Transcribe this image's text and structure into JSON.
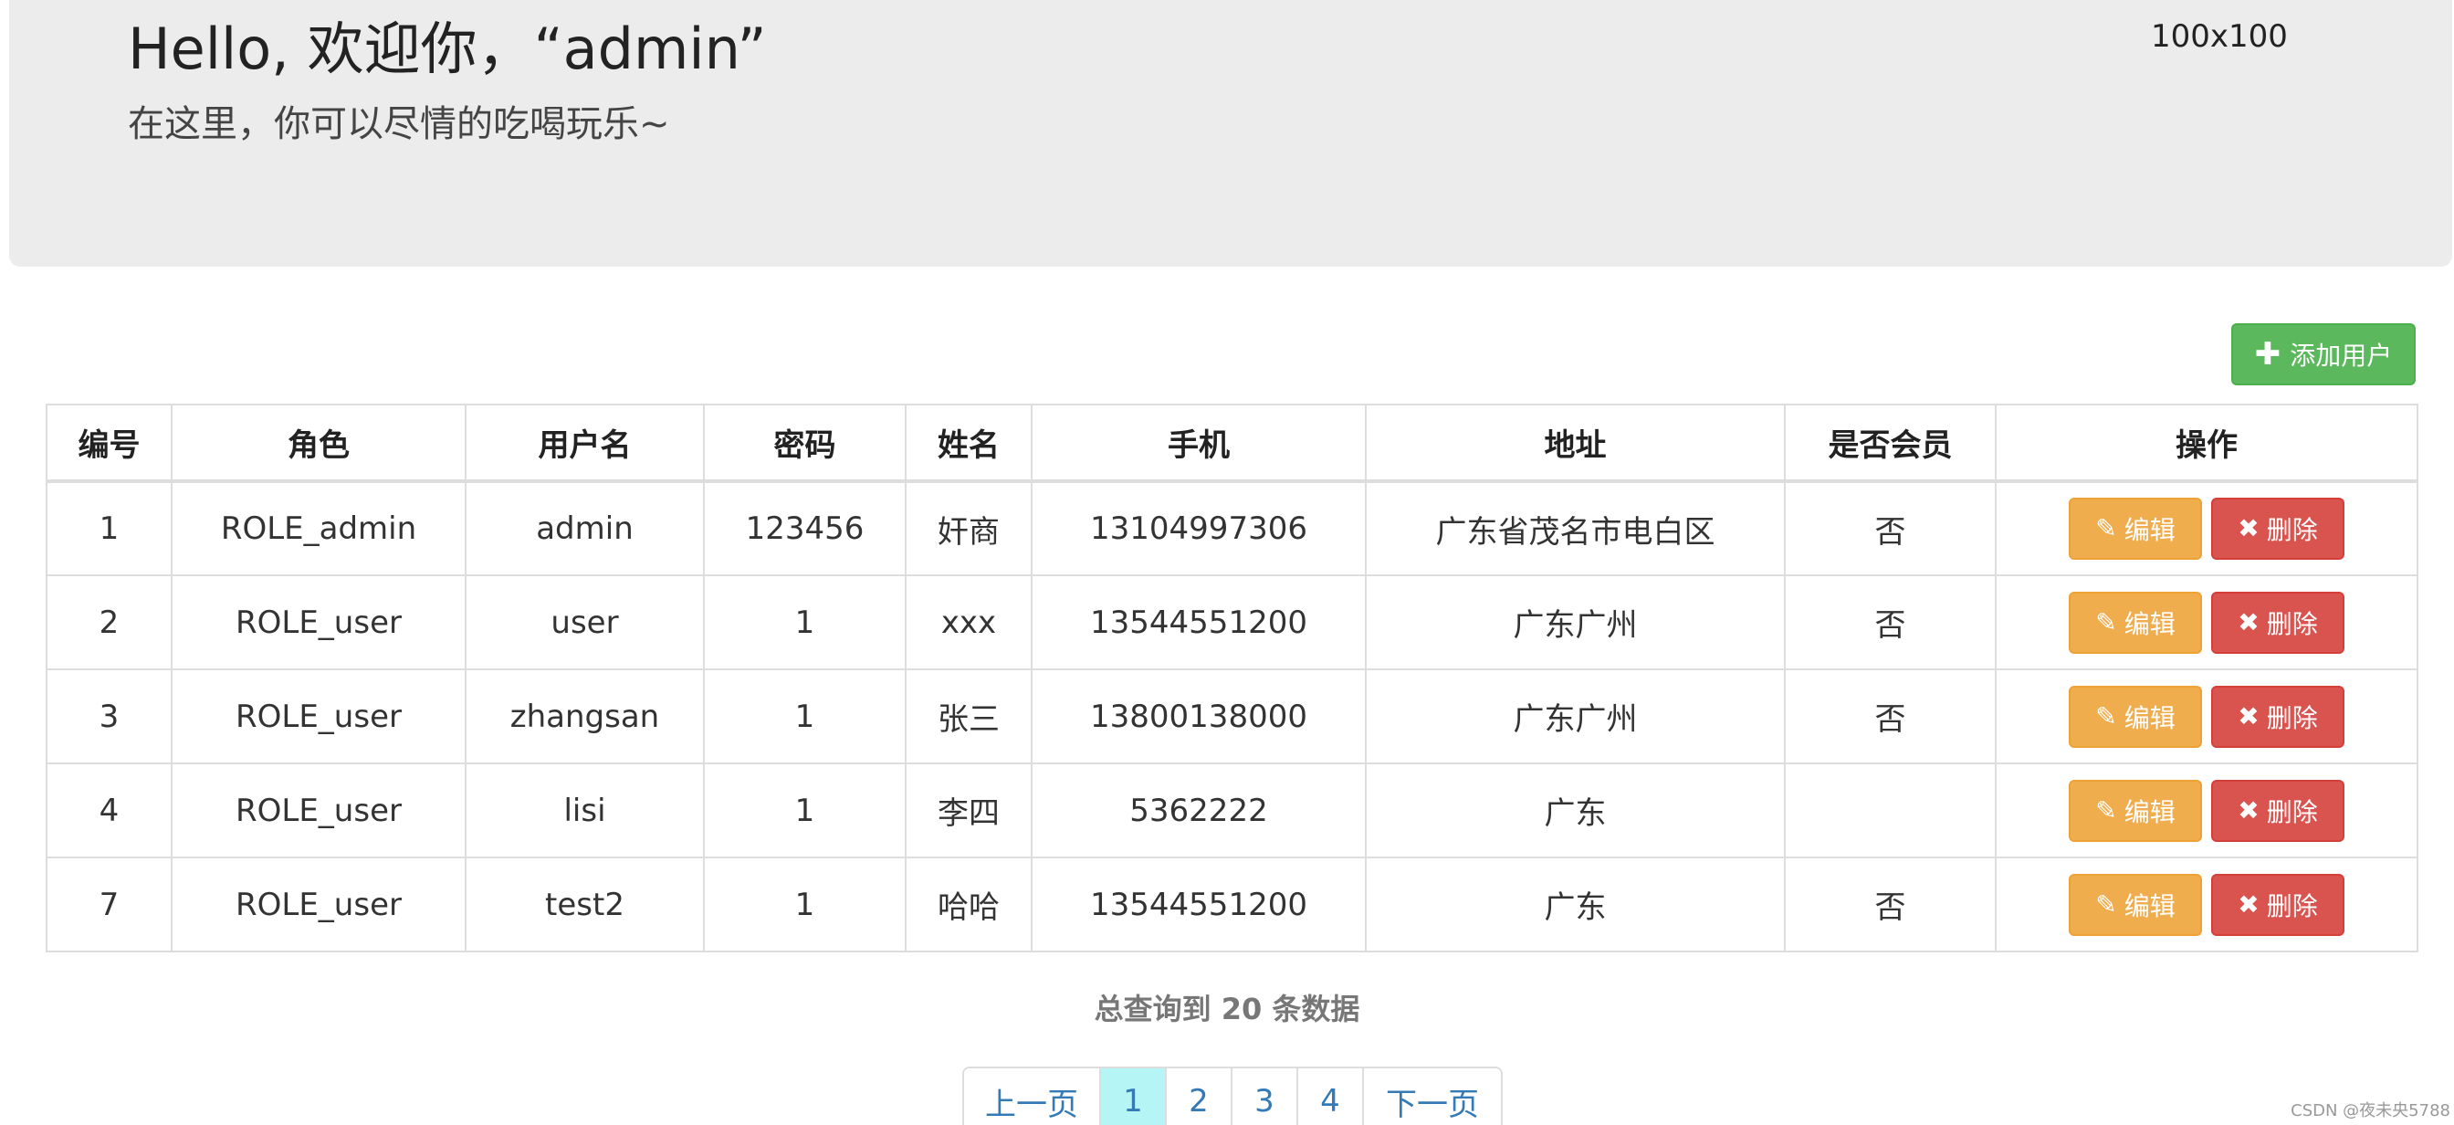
{
  "header": {
    "title": "Hello, 欢迎你，“admin”",
    "subtitle": "在这里，你可以尽情的吃喝玩乐~",
    "avatar_placeholder": "100x100"
  },
  "toolbar": {
    "add_user_label": "添加用户",
    "add_user_icon": "plus-icon"
  },
  "table": {
    "columns": [
      "编号",
      "角色",
      "用户名",
      "密码",
      "姓名",
      "手机",
      "地址",
      "是否会员",
      "操作"
    ],
    "rows": [
      {
        "id": "1",
        "role": "ROLE_admin",
        "username": "admin",
        "password": "123456",
        "name": "奸商",
        "phone": "13104997306",
        "address": "广东省茂名市电白区",
        "member": "否"
      },
      {
        "id": "2",
        "role": "ROLE_user",
        "username": "user",
        "password": "1",
        "name": "xxx",
        "phone": "13544551200",
        "address": "广东广州",
        "member": "否"
      },
      {
        "id": "3",
        "role": "ROLE_user",
        "username": "zhangsan",
        "password": "1",
        "name": "张三",
        "phone": "13800138000",
        "address": "广东广州",
        "member": "否"
      },
      {
        "id": "4",
        "role": "ROLE_user",
        "username": "lisi",
        "password": "1",
        "name": "李四",
        "phone": "5362222",
        "address": "广东",
        "member": ""
      },
      {
        "id": "7",
        "role": "ROLE_user",
        "username": "test2",
        "password": "1",
        "name": "哈哈",
        "phone": "13544551200",
        "address": "广东",
        "member": "否"
      }
    ],
    "actions": {
      "edit_label": "编辑",
      "edit_icon": "pencil-icon",
      "delete_label": "删除",
      "delete_icon": "close-icon"
    }
  },
  "summary": "总查询到 20 条数据",
  "pagination": {
    "prev_label": "上一页",
    "pages": [
      "1",
      "2",
      "3",
      "4"
    ],
    "active_page": "1",
    "next_label": "下一页"
  },
  "watermark": "CSDN @夜未央5788",
  "colors": {
    "add_button": "#5cb85c",
    "edit_button": "#f0ad4e",
    "delete_button": "#d9534f",
    "active_page_bg": "#b5f5f5",
    "link": "#337ab7"
  }
}
